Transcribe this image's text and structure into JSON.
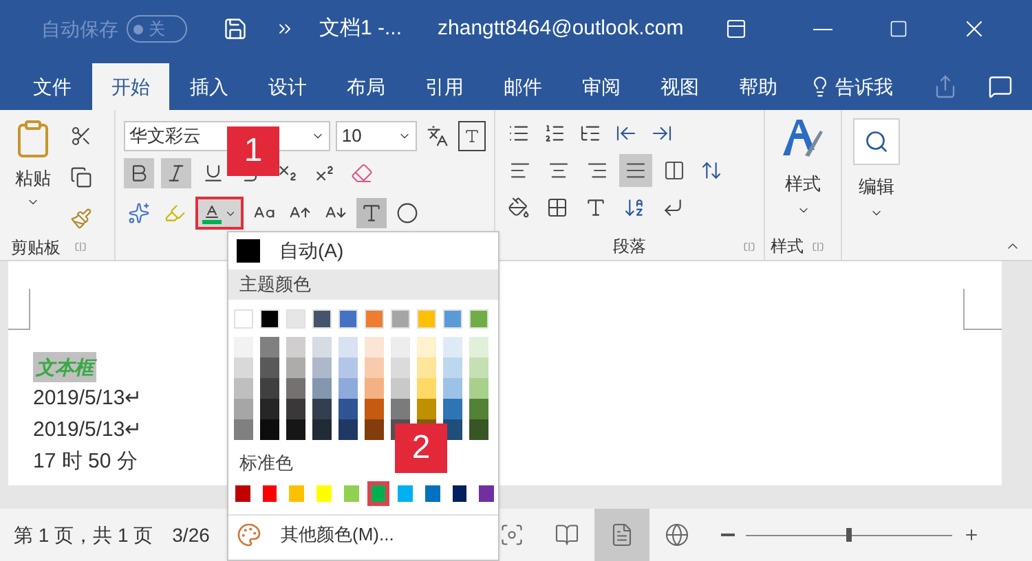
{
  "title_bar": {
    "autosave": {
      "label": "自动保存",
      "on": false,
      "toggle_label": "关"
    },
    "document_title": "文档1 -...",
    "account": "zhangtt8464@outlook.com"
  },
  "tabs": [
    {
      "label": "文件",
      "selected": false
    },
    {
      "label": "开始",
      "selected": true
    },
    {
      "label": "插入",
      "selected": false
    },
    {
      "label": "设计",
      "selected": false
    },
    {
      "label": "布局",
      "selected": false
    },
    {
      "label": "引用",
      "selected": false
    },
    {
      "label": "邮件",
      "selected": false
    },
    {
      "label": "审阅",
      "selected": false
    },
    {
      "label": "视图",
      "selected": false
    },
    {
      "label": "帮助",
      "selected": false
    }
  ],
  "tell_me": "告诉我",
  "ribbon": {
    "clipboard": {
      "paste_label": "粘贴",
      "group_label": "剪贴板"
    },
    "font": {
      "font_name": "华文彩云",
      "font_size": "10",
      "font_color": {
        "color": "#00b050",
        "highlighted": true
      }
    },
    "paragraph": {
      "group_label": "段落",
      "align": [
        {
          "kind": "left",
          "selected": false
        },
        {
          "kind": "center",
          "selected": false
        },
        {
          "kind": "right",
          "selected": false
        },
        {
          "kind": "justify",
          "selected": true
        },
        {
          "kind": "distributed",
          "selected": false
        }
      ]
    },
    "styles": {
      "label": "样式",
      "group_label": "样式"
    },
    "editing": {
      "label": "编辑"
    }
  },
  "document": {
    "lines": [
      {
        "kind": "styled",
        "text": "文本框"
      },
      {
        "kind": "plain",
        "text": "2019/5/13↵"
      },
      {
        "kind": "plain",
        "text": "2019/5/13↵"
      },
      {
        "kind": "plain",
        "text": "17 时 50 分"
      }
    ]
  },
  "status_bar": {
    "page": "第 1 页，共 1 页",
    "words": "3/26",
    "views": [
      {
        "kind": "focus",
        "selected": false
      },
      {
        "kind": "read",
        "selected": false
      },
      {
        "kind": "print",
        "selected": true
      },
      {
        "kind": "web",
        "selected": false
      }
    ],
    "zoom": {
      "level": 0.5
    }
  },
  "color_menu": {
    "automatic": {
      "label": "自动(A)",
      "color": "#000000"
    },
    "theme_header": "主题颜色",
    "theme_colors": [
      {
        "color": "#ffffff",
        "shades": [
          {
            "color": "#f2f2f2"
          },
          {
            "color": "#d9d9d9"
          },
          {
            "color": "#bfbfbf"
          },
          {
            "color": "#a6a6a6"
          },
          {
            "color": "#808080"
          }
        ]
      },
      {
        "color": "#000000",
        "shades": [
          {
            "color": "#808080"
          },
          {
            "color": "#595959"
          },
          {
            "color": "#404040"
          },
          {
            "color": "#262626"
          },
          {
            "color": "#0d0d0d"
          }
        ]
      },
      {
        "color": "#e7e6e6",
        "shades": [
          {
            "color": "#d0cece"
          },
          {
            "color": "#aeabab"
          },
          {
            "color": "#757171"
          },
          {
            "color": "#3a3838"
          },
          {
            "color": "#171616"
          }
        ]
      },
      {
        "color": "#44546a",
        "shades": [
          {
            "color": "#d6dce4"
          },
          {
            "color": "#adb9ca"
          },
          {
            "color": "#8497b0"
          },
          {
            "color": "#333f4f"
          },
          {
            "color": "#222a35"
          }
        ]
      },
      {
        "color": "#4472c4",
        "shades": [
          {
            "color": "#d9e2f3"
          },
          {
            "color": "#b4c6e7"
          },
          {
            "color": "#8eaadb"
          },
          {
            "color": "#2f5496"
          },
          {
            "color": "#1f3864"
          }
        ]
      },
      {
        "color": "#ed7d31",
        "shades": [
          {
            "color": "#fbe5d5"
          },
          {
            "color": "#f7cbac"
          },
          {
            "color": "#f4b183"
          },
          {
            "color": "#c55a11"
          },
          {
            "color": "#833c0b"
          }
        ]
      },
      {
        "color": "#a5a5a5",
        "shades": [
          {
            "color": "#ededed"
          },
          {
            "color": "#dbdbdb"
          },
          {
            "color": "#c9c9c9"
          },
          {
            "color": "#7b7b7b"
          },
          {
            "color": "#525252"
          }
        ]
      },
      {
        "color": "#ffc000",
        "shades": [
          {
            "color": "#fff2cc"
          },
          {
            "color": "#fee599"
          },
          {
            "color": "#ffd965"
          },
          {
            "color": "#bf9000"
          },
          {
            "color": "#7f6000"
          }
        ]
      },
      {
        "color": "#5b9bd5",
        "shades": [
          {
            "color": "#deebf6"
          },
          {
            "color": "#bdd7ee"
          },
          {
            "color": "#9cc3e5"
          },
          {
            "color": "#2e75b5"
          },
          {
            "color": "#1e4e79"
          }
        ]
      },
      {
        "color": "#70ad47",
        "shades": [
          {
            "color": "#e2efd9"
          },
          {
            "color": "#c5e0b3"
          },
          {
            "color": "#a8d08d"
          },
          {
            "color": "#538135"
          },
          {
            "color": "#375623"
          }
        ]
      }
    ],
    "standard_header": "标准色",
    "standard_colors": [
      {
        "color": "#c00000",
        "selected": false
      },
      {
        "color": "#ff0000",
        "selected": false
      },
      {
        "color": "#ffc000",
        "selected": false
      },
      {
        "color": "#ffff00",
        "selected": false
      },
      {
        "color": "#92d050",
        "selected": false
      },
      {
        "color": "#00b050",
        "selected": true
      },
      {
        "color": "#00b0f0",
        "selected": false
      },
      {
        "color": "#0070c0",
        "selected": false
      },
      {
        "color": "#002060",
        "selected": false
      },
      {
        "color": "#7030a0",
        "selected": false
      }
    ],
    "more_colors": "其他颜色(M)..."
  },
  "callouts": [
    {
      "label": "1"
    },
    {
      "label": "2"
    }
  ]
}
